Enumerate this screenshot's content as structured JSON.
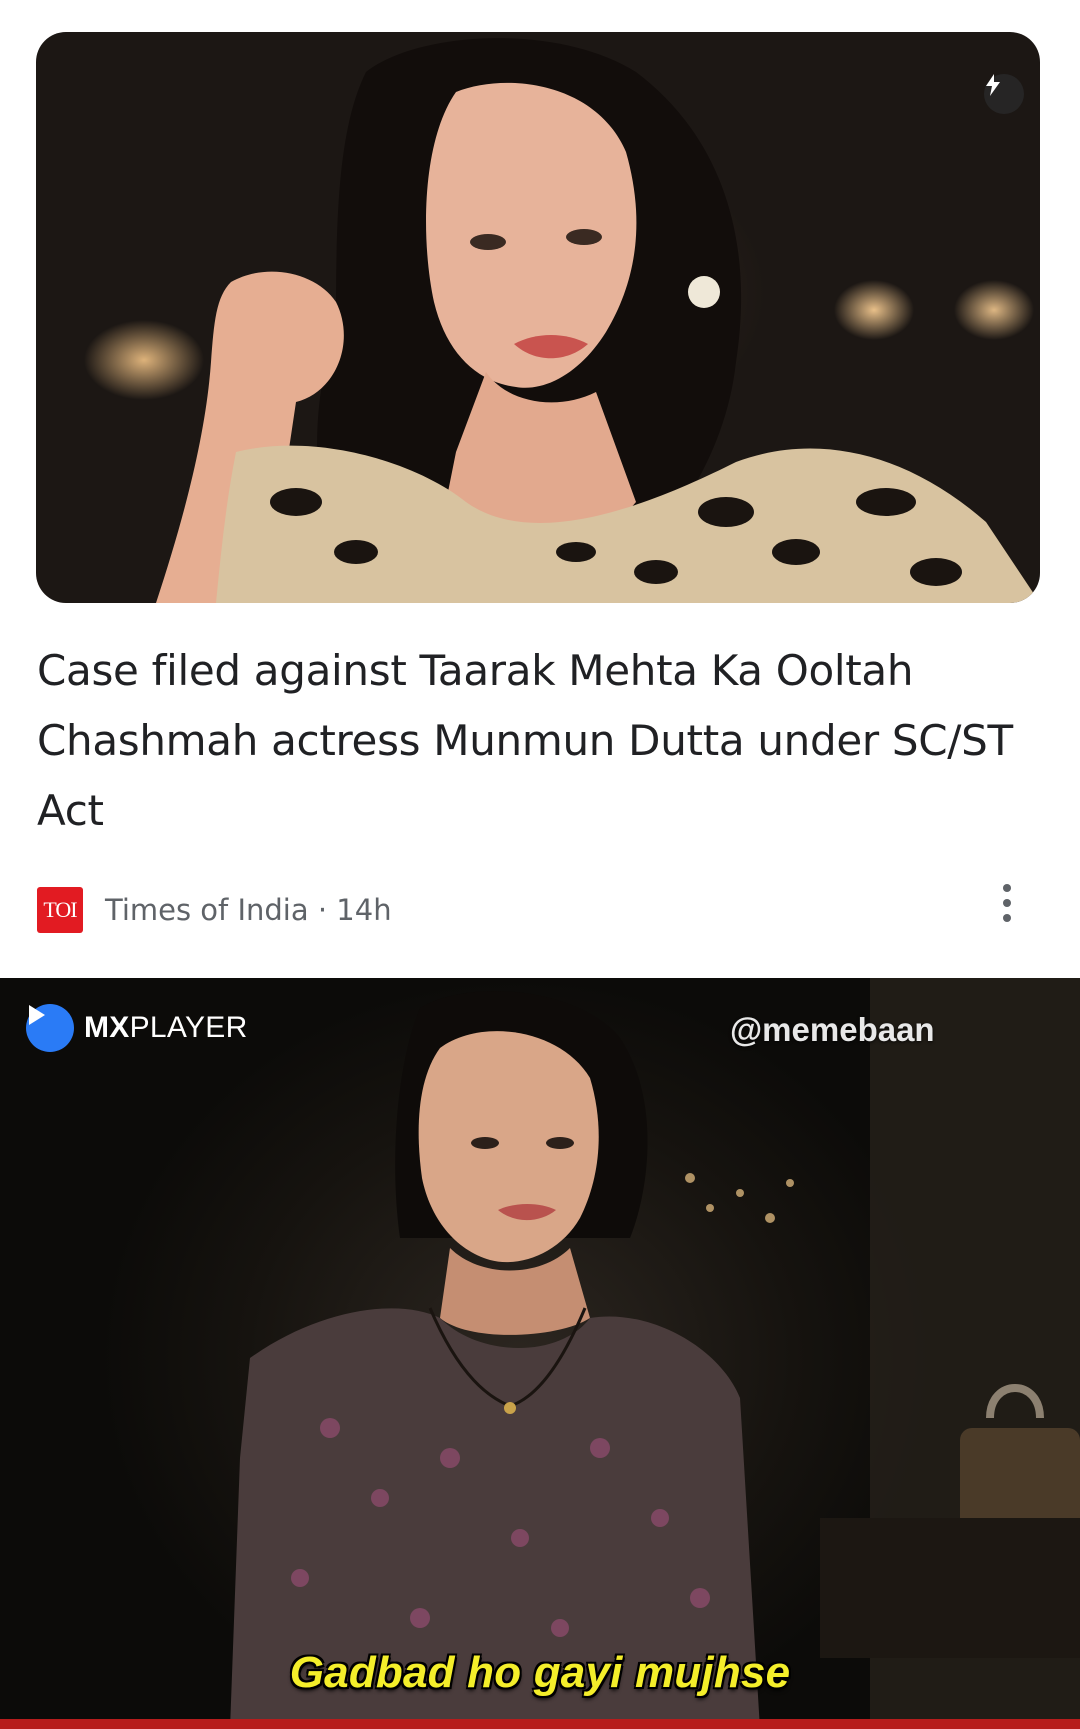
{
  "news_card": {
    "headline": "Case filed against Taarak Mehta Ka Ooltah Chashmah actress Munmun Dutta under SC/ST Act",
    "source_logo_text": "TOI",
    "source": "Times of India · 14h",
    "flash_icon": "bolt-icon",
    "more_icon": "more-vertical-icon",
    "colors": {
      "source_logo": "#e21b22",
      "headline": "#202124",
      "meta": "#5f6368"
    }
  },
  "meme": {
    "brand_bold": "MX",
    "brand_rest": "PLAYER",
    "watermark": "@memebaan",
    "subtitle": "Gadbad ho gayi mujhse",
    "colors": {
      "subtitle": "#f4ee2a",
      "brand_accent": "#2a7bf6"
    }
  }
}
